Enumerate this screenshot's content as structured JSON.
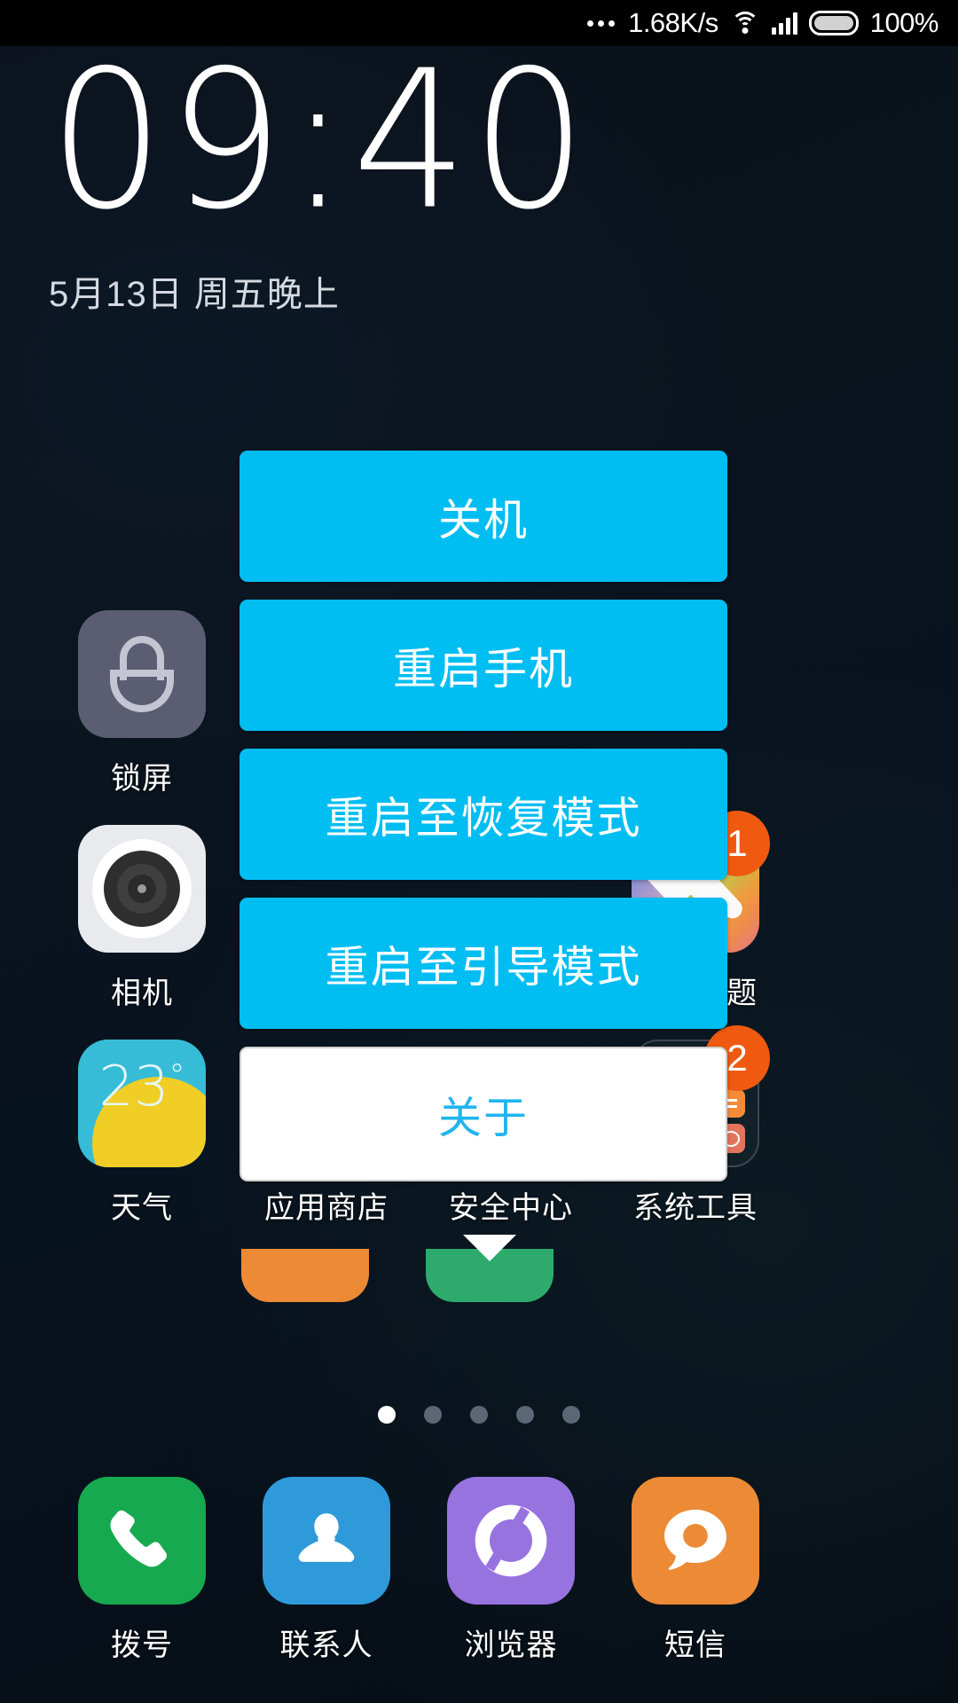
{
  "status_bar": {
    "network_speed": "1.68K/s",
    "battery_percent": "100%",
    "icons": [
      "more-dots-icon",
      "wifi-icon",
      "signal-icon",
      "battery-icon"
    ]
  },
  "lockscreen": {
    "time": "09:40",
    "date": "5月13日 周五晚上"
  },
  "dialog": {
    "buttons": [
      {
        "label": "关机",
        "style": "primary"
      },
      {
        "label": "重启手机",
        "style": "primary"
      },
      {
        "label": "重启至恢复模式",
        "style": "primary"
      },
      {
        "label": "重启至引导模式",
        "style": "primary"
      },
      {
        "label": "关于",
        "style": "secondary"
      }
    ]
  },
  "home": {
    "apps": [
      {
        "name": "锁屏",
        "icon": "lock-icon",
        "badge": ""
      },
      {
        "name": "相机",
        "icon": "camera-icon",
        "badge": ""
      },
      {
        "name": "天气",
        "icon": "weather-icon",
        "badge": "",
        "temperature": "23",
        "degree": "°"
      },
      {
        "name": "个性主题",
        "icon": "paintbrush-icon",
        "badge": "1"
      },
      {
        "name": "应用商店",
        "icon": "appstore-icon",
        "badge": ""
      },
      {
        "name": "安全中心",
        "icon": "shield-icon",
        "badge": ""
      },
      {
        "name": "系统工具",
        "icon": "folder-icon",
        "badge": "2"
      }
    ],
    "page_dots": {
      "count": 5,
      "active_index": 0
    }
  },
  "dock": {
    "items": [
      {
        "name": "拨号",
        "icon": "phone-icon"
      },
      {
        "name": "联系人",
        "icon": "person-icon"
      },
      {
        "name": "浏览器",
        "icon": "browser-icon"
      },
      {
        "name": "短信",
        "icon": "message-icon"
      }
    ]
  },
  "colors": {
    "accent_blue": "#00bdf2",
    "badge_orange": "#ef5a10",
    "background": "#0a1018",
    "weather_cyan": "#37bcd8",
    "phone_green": "#16a94f",
    "contacts_blue": "#2e9ada",
    "browser_purple": "#9773e0",
    "sms_orange": "#ec8a35"
  }
}
